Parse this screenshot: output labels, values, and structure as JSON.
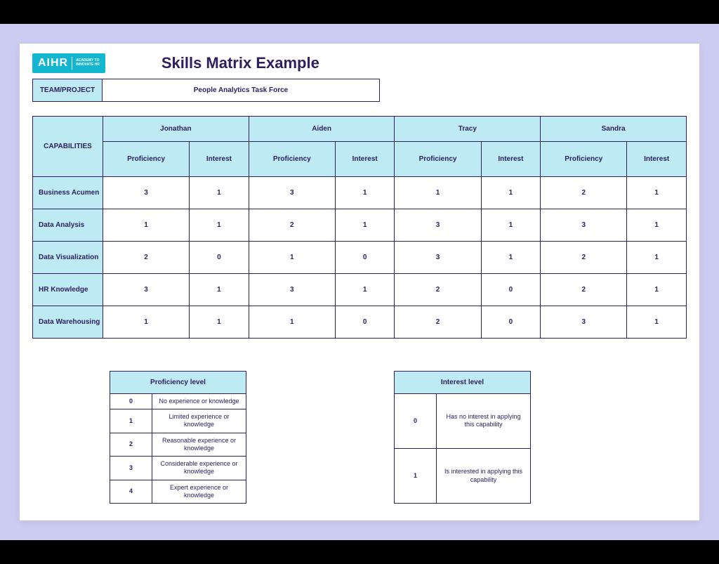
{
  "logo": {
    "main": "AIHR",
    "sub1": "ACADEMY TO",
    "sub2": "INNOVATE HR"
  },
  "title": "Skills Matrix Example",
  "team": {
    "label": "TEAM/PROJECT",
    "value": "People Analytics Task Force"
  },
  "headers": {
    "capabilities": "CAPABILITIES",
    "proficiency": "Proficiency",
    "interest": "Interest"
  },
  "people": [
    "Jonathan",
    "Aiden",
    "Tracy",
    "Sandra"
  ],
  "rows": [
    {
      "label": "Business Acumen",
      "vals": [
        3,
        1,
        3,
        1,
        1,
        1,
        2,
        1
      ]
    },
    {
      "label": "Data Analysis",
      "vals": [
        1,
        1,
        2,
        1,
        3,
        1,
        3,
        1
      ]
    },
    {
      "label": "Data Visualization",
      "vals": [
        2,
        0,
        1,
        0,
        3,
        1,
        2,
        1
      ]
    },
    {
      "label": "HR Knowledge",
      "vals": [
        3,
        1,
        3,
        1,
        2,
        0,
        2,
        1
      ]
    },
    {
      "label": "Data Warehousing",
      "vals": [
        1,
        1,
        1,
        0,
        2,
        0,
        3,
        1
      ]
    }
  ],
  "legend_prof": {
    "title": "Proficiency level",
    "items": [
      {
        "lv": "0",
        "txt": "No experience or knowledge"
      },
      {
        "lv": "1",
        "txt": "Limited experience or knowledge"
      },
      {
        "lv": "2",
        "txt": "Reasonable experience or knowledge"
      },
      {
        "lv": "3",
        "txt": "Considerable experience or knowledge"
      },
      {
        "lv": "4",
        "txt": "Expert experience or knowledge"
      }
    ]
  },
  "legend_int": {
    "title": "Interest level",
    "items": [
      {
        "lv": "0",
        "txt": "Has no interest in applying this capability"
      },
      {
        "lv": "1",
        "txt": "Is interested in applying this capability"
      }
    ]
  }
}
